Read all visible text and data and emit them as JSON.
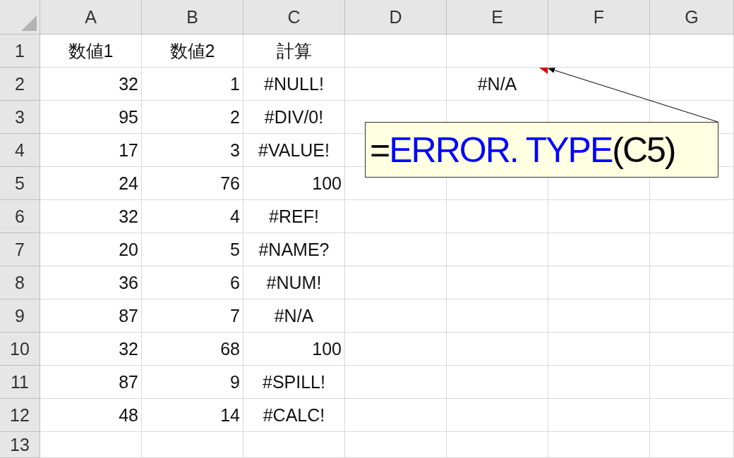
{
  "columns": [
    "A",
    "B",
    "C",
    "D",
    "E",
    "F",
    "G"
  ],
  "rows": [
    {
      "header": "1",
      "cells": [
        {
          "text": "数値1",
          "kind": "label"
        },
        {
          "text": "数値2",
          "kind": "label"
        },
        {
          "text": "計算",
          "kind": "label"
        },
        {},
        {},
        {},
        {}
      ]
    },
    {
      "header": "2",
      "cells": [
        {
          "text": "32",
          "kind": "number"
        },
        {
          "text": "1",
          "kind": "number"
        },
        {
          "text": "#NULL!",
          "kind": "error"
        },
        {},
        {
          "text": "#N/A",
          "kind": "error",
          "comment": true
        },
        {},
        {}
      ]
    },
    {
      "header": "3",
      "cells": [
        {
          "text": "95",
          "kind": "number"
        },
        {
          "text": "2",
          "kind": "number"
        },
        {
          "text": "#DIV/0!",
          "kind": "error"
        },
        {},
        {},
        {},
        {}
      ]
    },
    {
      "header": "4",
      "cells": [
        {
          "text": "17",
          "kind": "number"
        },
        {
          "text": "3",
          "kind": "number"
        },
        {
          "text": "#VALUE!",
          "kind": "error"
        },
        {},
        {},
        {},
        {}
      ]
    },
    {
      "header": "5",
      "cells": [
        {
          "text": "24",
          "kind": "number"
        },
        {
          "text": "76",
          "kind": "number"
        },
        {
          "text": "100",
          "kind": "number"
        },
        {},
        {},
        {},
        {}
      ]
    },
    {
      "header": "6",
      "cells": [
        {
          "text": "32",
          "kind": "number"
        },
        {
          "text": "4",
          "kind": "number"
        },
        {
          "text": "#REF!",
          "kind": "error"
        },
        {},
        {},
        {},
        {}
      ]
    },
    {
      "header": "7",
      "cells": [
        {
          "text": "20",
          "kind": "number"
        },
        {
          "text": "5",
          "kind": "number"
        },
        {
          "text": "#NAME?",
          "kind": "error"
        },
        {},
        {},
        {},
        {}
      ]
    },
    {
      "header": "8",
      "cells": [
        {
          "text": "36",
          "kind": "number"
        },
        {
          "text": "6",
          "kind": "number"
        },
        {
          "text": "#NUM!",
          "kind": "error"
        },
        {},
        {},
        {},
        {}
      ]
    },
    {
      "header": "9",
      "cells": [
        {
          "text": "87",
          "kind": "number"
        },
        {
          "text": "7",
          "kind": "number"
        },
        {
          "text": "#N/A",
          "kind": "error"
        },
        {},
        {},
        {},
        {}
      ]
    },
    {
      "header": "10",
      "cells": [
        {
          "text": "32",
          "kind": "number"
        },
        {
          "text": "68",
          "kind": "number"
        },
        {
          "text": "100",
          "kind": "number"
        },
        {},
        {},
        {},
        {}
      ]
    },
    {
      "header": "11",
      "cells": [
        {
          "text": "87",
          "kind": "number"
        },
        {
          "text": "9",
          "kind": "number"
        },
        {
          "text": "#SPILL!",
          "kind": "error"
        },
        {},
        {},
        {},
        {}
      ]
    },
    {
      "header": "12",
      "cells": [
        {
          "text": "48",
          "kind": "number"
        },
        {
          "text": "14",
          "kind": "number"
        },
        {
          "text": "#CALC!",
          "kind": "error"
        },
        {},
        {},
        {},
        {}
      ]
    },
    {
      "header": "13",
      "cells": [
        {},
        {},
        {},
        {},
        {},
        {},
        {}
      ]
    }
  ],
  "callout": {
    "segments": [
      {
        "text": "=",
        "color": "#000000"
      },
      {
        "text": "ERROR. TYPE",
        "color": "#0000ff"
      },
      {
        "text": "(C5)",
        "color": "#000000"
      }
    ]
  }
}
